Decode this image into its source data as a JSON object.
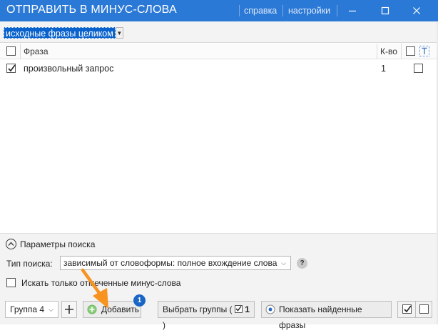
{
  "window": {
    "title": "ОТПРАВИТЬ В МИНУС-СЛОВА",
    "help_link": "справка",
    "settings_link": "настройки"
  },
  "toolbar": {
    "mode_select": "исходные фразы целиком"
  },
  "table": {
    "col_phrase": "Фраза",
    "col_count": "К-во",
    "rows": [
      {
        "phrase": "произвольный запрос",
        "count": "1",
        "checked": true
      }
    ]
  },
  "search_params": {
    "header": "Параметры поиска",
    "search_type_label": "Тип поиска:",
    "search_type_value": "зависимый от словоформы: полное вхождение слова",
    "help": "?",
    "only_marked_label": "Искать только отмеченные минус-слова"
  },
  "bottom": {
    "group_select": "Группа 4",
    "add_label": "Добавить",
    "badge": "1",
    "choose_groups_prefix": "Выбрать группы (",
    "choose_groups_count": "1",
    "choose_groups_suffix": ")",
    "show_found_label": "Показать найденные фразы"
  },
  "colors": {
    "titlebar": "#2b79d7",
    "selection": "#0a63cc",
    "badge": "#1a66c6",
    "arrow": "#f7931e"
  }
}
